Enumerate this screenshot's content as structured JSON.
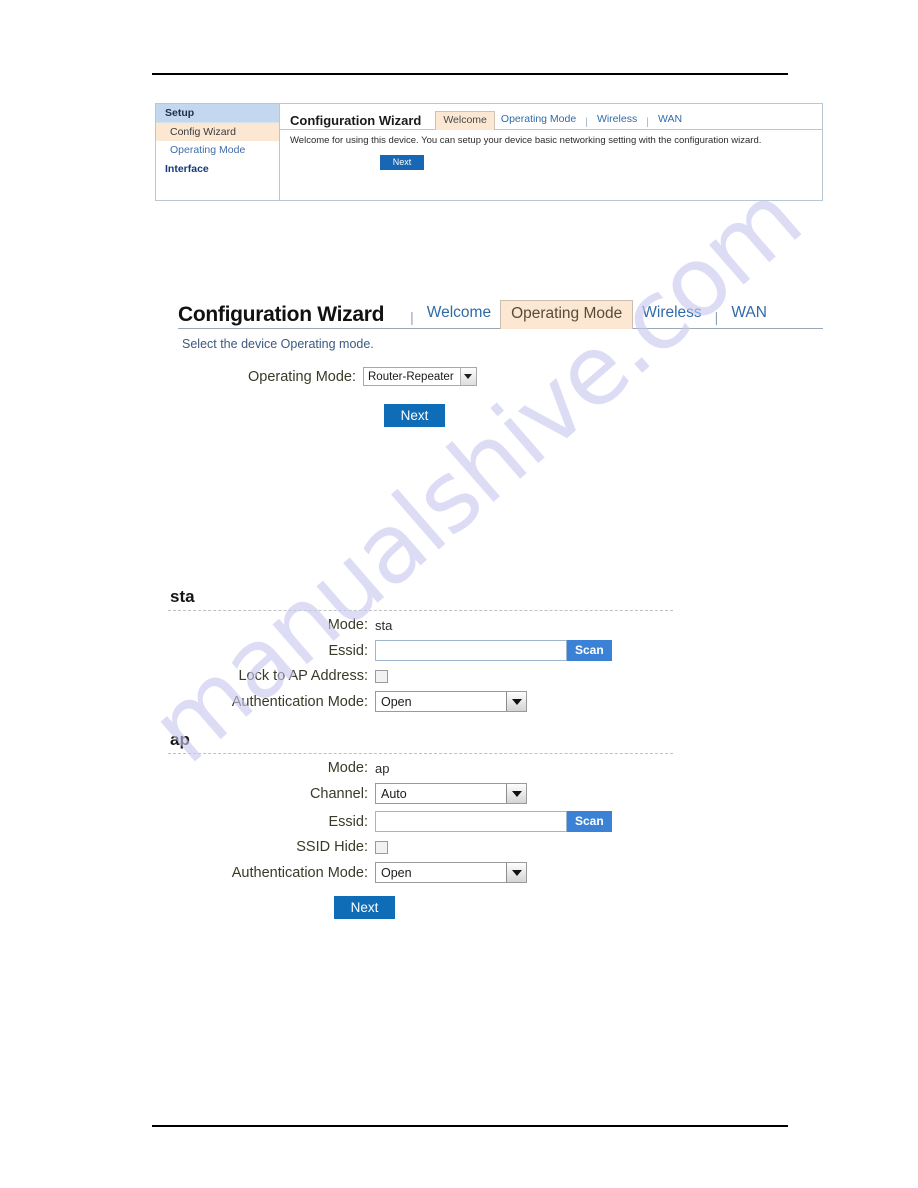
{
  "figure1": {
    "sidebar": {
      "header": "Setup",
      "items": [
        {
          "label": "Config Wizard",
          "active": true
        },
        {
          "label": "Operating Mode",
          "active": false
        }
      ],
      "footer_header": "Interface"
    },
    "title": "Configuration Wizard",
    "tabs": [
      {
        "label": "Welcome",
        "active": true
      },
      {
        "label": "Operating Mode",
        "active": false
      },
      {
        "label": "Wireless",
        "active": false
      },
      {
        "label": "WAN",
        "active": false
      }
    ],
    "description": "Welcome for using this device. You can setup your device basic networking setting with the configuration wizard.",
    "next_label": "Next"
  },
  "figure2": {
    "title": "Configuration Wizard",
    "tabs": [
      {
        "label": "Welcome",
        "active": false
      },
      {
        "label": "Operating Mode",
        "active": true
      },
      {
        "label": "Wireless",
        "active": false
      },
      {
        "label": "WAN",
        "active": false
      }
    ],
    "description": "Select the device Operating mode.",
    "operating_mode_label": "Operating Mode:",
    "operating_mode_value": "Router-Repeater",
    "next_label": "Next"
  },
  "figure3": {
    "sta": {
      "heading": "sta",
      "mode_label": "Mode:",
      "mode_value": "sta",
      "essid_label": "Essid:",
      "essid_value": "",
      "scan_label": "Scan",
      "lock_label": "Lock to AP Address:",
      "lock_checked": false,
      "auth_label": "Authentication Mode:",
      "auth_value": "Open"
    },
    "ap": {
      "heading": "ap",
      "mode_label": "Mode:",
      "mode_value": "ap",
      "channel_label": "Channel:",
      "channel_value": "Auto",
      "essid_label": "Essid:",
      "essid_value": "",
      "scan_label": "Scan",
      "ssid_hide_label": "SSID Hide:",
      "ssid_hide_checked": false,
      "auth_label": "Authentication Mode:",
      "auth_value": "Open"
    },
    "next_label": "Next"
  },
  "watermark": {
    "text": "manualshive.com",
    "color": "#c9c8ef"
  },
  "colors": {
    "accent_blue": "#1867b4",
    "scan_blue": "#3b82d6",
    "active_tab_bg": "#fbe7d2",
    "sidebar_header_bg": "#c3d7ee",
    "link_blue": "#2f6ba8"
  }
}
